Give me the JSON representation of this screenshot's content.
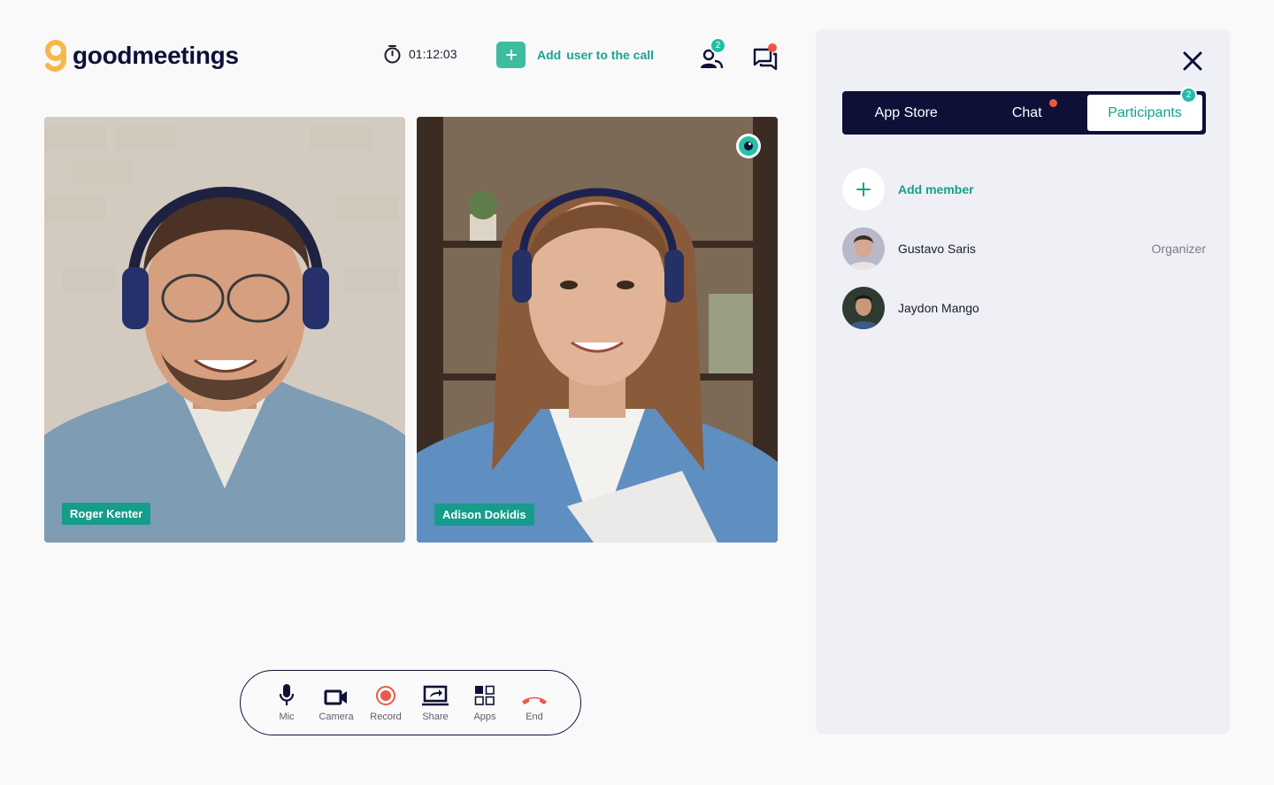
{
  "app": {
    "logo_mark": "g",
    "logo_text": "goodmeetings"
  },
  "header": {
    "timer": "01:12:03",
    "add_user_bold": "Add",
    "add_user_rest": "user to the call",
    "participants_count": "2"
  },
  "videos": [
    {
      "name": "Roger Kenter",
      "speaking": false
    },
    {
      "name": "Adison Dokidis",
      "speaking": true
    }
  ],
  "controls": [
    {
      "label": "Mic",
      "icon": "mic-icon"
    },
    {
      "label": "Camera",
      "icon": "camera-icon"
    },
    {
      "label": "Record",
      "icon": "record-icon"
    },
    {
      "label": "Share",
      "icon": "share-screen-icon"
    },
    {
      "label": "Apps",
      "icon": "apps-grid-icon"
    },
    {
      "label": "End",
      "icon": "end-call-icon"
    }
  ],
  "panel": {
    "tabs": [
      {
        "label": "App Store"
      },
      {
        "label": "Chat"
      },
      {
        "label": "Participants",
        "badge": "2"
      }
    ],
    "active_tab": "Participants",
    "add_member_label": "Add member",
    "participants": [
      {
        "name": "Gustavo Saris",
        "role": "Organizer"
      },
      {
        "name": "Jaydon Mango",
        "role": ""
      }
    ]
  },
  "colors": {
    "navy": "#0f1038",
    "teal": "#169c8b",
    "accent_green": "#3bbd9e",
    "alert_red": "#ec5a3d",
    "panel_bg": "#eef0f5"
  }
}
